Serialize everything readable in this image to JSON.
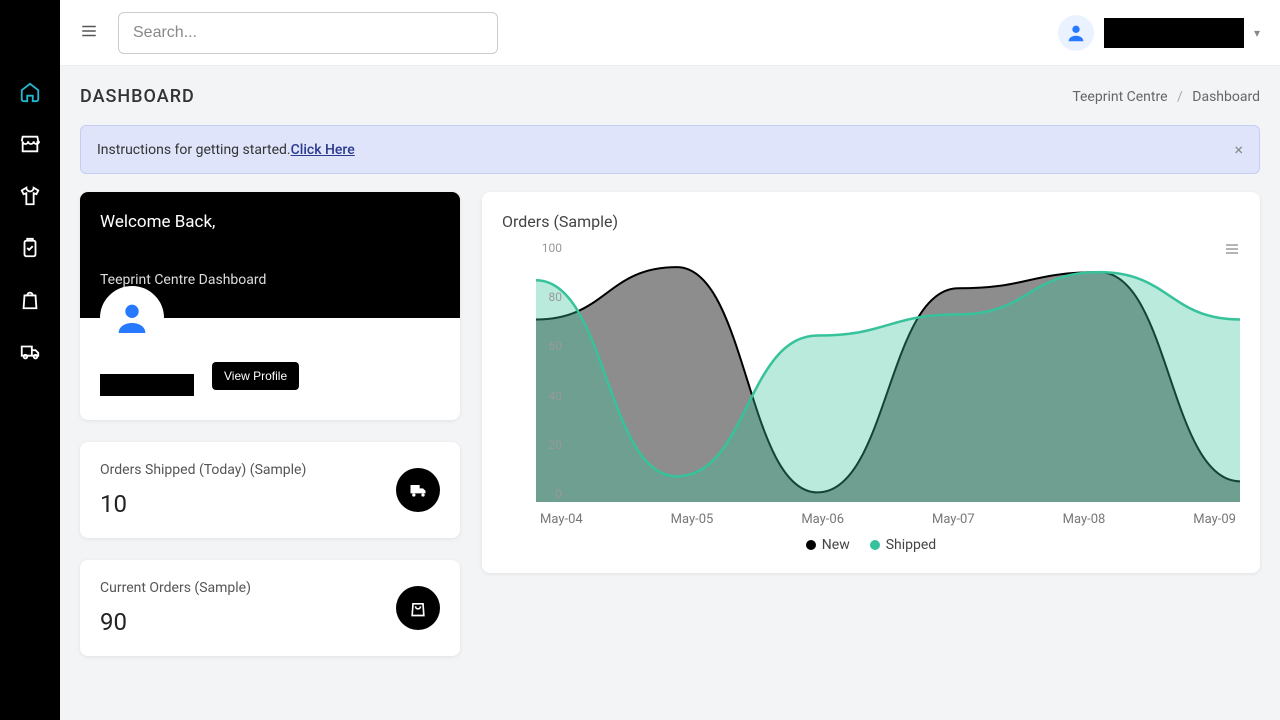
{
  "topbar": {
    "search_placeholder": "Search...",
    "user_name": "████████"
  },
  "page": {
    "title": "DASHBOARD",
    "breadcrumb_root": "Teeprint Centre",
    "breadcrumb_current": "Dashboard"
  },
  "alert": {
    "text": "Instructions for getting started. ",
    "link": "Click Here"
  },
  "welcome": {
    "heading": "Welcome Back,",
    "sub": "Teeprint Centre Dashboard",
    "view_profile": "View Profile"
  },
  "stats": {
    "shipped_label": "Orders Shipped (Today) (Sample)",
    "shipped_value": "10",
    "current_label": "Current Orders (Sample)",
    "current_value": "90"
  },
  "chart": {
    "title": "Orders (Sample)",
    "legend_new": "New",
    "legend_shipped": "Shipped",
    "xticks": [
      "May-04",
      "May-05",
      "May-06",
      "May-07",
      "May-08",
      "May-09"
    ],
    "yticks": [
      "100",
      "80",
      "60",
      "40",
      "20",
      "0"
    ]
  },
  "chart_data": {
    "type": "area",
    "title": "Orders (Sample)",
    "xlabel": "",
    "ylabel": "",
    "ylim": [
      0,
      100
    ],
    "categories": [
      "May-04",
      "May-05",
      "May-06",
      "May-07",
      "May-08",
      "May-09"
    ],
    "series": [
      {
        "name": "New",
        "color": "#000000",
        "values": [
          70,
          90,
          4,
          82,
          88,
          8
        ]
      },
      {
        "name": "Shipped",
        "color": "#37c29b",
        "values": [
          85,
          10,
          64,
          72,
          88,
          70
        ]
      }
    ]
  },
  "colors": {
    "new": "#000000",
    "shipped": "#37c29b",
    "shipped_fill": "rgba(55,194,155,0.35)",
    "new_fill": "rgba(80,80,80,0.6)"
  }
}
